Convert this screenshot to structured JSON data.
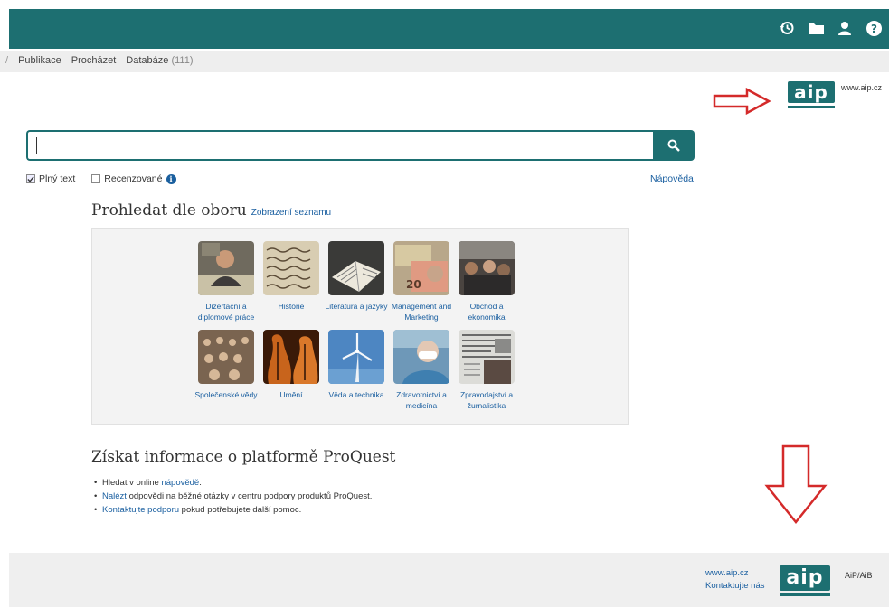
{
  "topbar": {
    "icons": [
      "history-icon",
      "folder-icon",
      "user-icon",
      "help-icon"
    ],
    "color": "#1d6f71"
  },
  "nav": {
    "items": [
      "Publikace",
      "Procházet",
      "Databáze"
    ],
    "db_count": "(111)"
  },
  "aip": {
    "logo_text": "aip",
    "url": "www.aip.cz"
  },
  "search": {
    "value": "",
    "button_icon": "search-icon"
  },
  "options": {
    "fulltext_label": "Plný text",
    "fulltext_checked": true,
    "peer_label": "Recenzované",
    "peer_checked": false,
    "help_label": "Nápověda"
  },
  "browse": {
    "title": "Prohledat dle oboru",
    "list_link": "Zobrazení seznamu",
    "subjects": [
      {
        "label": "Dizertační a diplomové práce"
      },
      {
        "label": "Historie"
      },
      {
        "label": "Literatura a jazyky"
      },
      {
        "label": "Management and Marketing"
      },
      {
        "label": "Obchod a ekonomika"
      },
      {
        "label": "Společenské vědy"
      },
      {
        "label": "Umění"
      },
      {
        "label": "Věda a technika"
      },
      {
        "label": "Zdravotnictví a medicína"
      },
      {
        "label": "Zpravodajství a žurnalistika"
      }
    ]
  },
  "info": {
    "title": "Získat informace o platformě ProQuest",
    "item1_pre": "Hledat v online ",
    "item1_link": "nápovědě",
    "item1_post": ".",
    "item2_link": "Nalézt",
    "item2_text": " odpovědi na běžné otázky v centru podpory produktů ProQuest.",
    "item3_link": "Kontaktujte podporu",
    "item3_text": " pokud potřebujete další pomoc."
  },
  "footer": {
    "url": "www.aip.cz",
    "contact": "Kontaktujte nás",
    "logo_text": "aip",
    "aib": "AiP/AiB"
  }
}
